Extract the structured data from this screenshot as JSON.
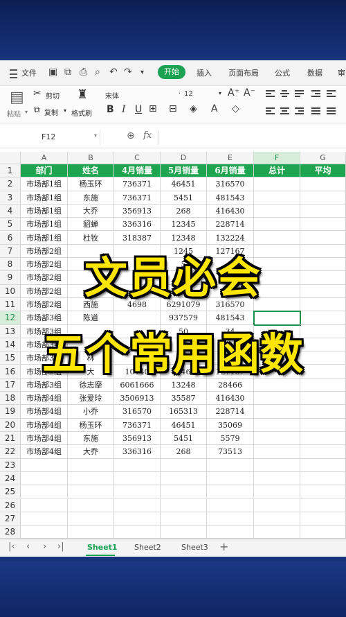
{
  "menu": {
    "file": "文件",
    "active_tab": "开始",
    "tabs": [
      "插入",
      "页面布局",
      "公式",
      "数据",
      "审"
    ]
  },
  "ribbon": {
    "cut": "剪切",
    "paste": "粘贴",
    "copy": "复制",
    "format_painter": "格式刷",
    "font_name": "宋体",
    "font_size": "12"
  },
  "formula_bar": {
    "cell_ref": "F12",
    "fx": "fx"
  },
  "columns": [
    "A",
    "B",
    "C",
    "D",
    "E",
    "F",
    "G"
  ],
  "header_row": [
    "部门",
    "姓名",
    "4月销量",
    "5月销量",
    "6月销量",
    "总计",
    "平均"
  ],
  "rows": [
    [
      "市场部1组",
      "杨玉环",
      "736371",
      "46451",
      "316570",
      "",
      ""
    ],
    [
      "市场部1组",
      "东施",
      "736371",
      "5451",
      "481543",
      "",
      ""
    ],
    [
      "市场部1组",
      "大乔",
      "356913",
      "268",
      "416430",
      "",
      ""
    ],
    [
      "市场部1组",
      "貂蝉",
      "336316",
      "12345",
      "228714",
      "",
      ""
    ],
    [
      "市场部1组",
      "杜牧",
      "318387",
      "12348",
      "132224",
      "",
      ""
    ],
    [
      "市场部2组",
      "",
      "",
      "1245",
      "127167",
      "",
      ""
    ],
    [
      "市场部2组",
      "",
      "",
      "5",
      "",
      "",
      ""
    ],
    [
      "市场部2组",
      "",
      "",
      "",
      "",
      "",
      ""
    ],
    [
      "市场部2组",
      "",
      "",
      "31",
      "366",
      "",
      ""
    ],
    [
      "市场部2组",
      "西施",
      "4698",
      "6291079",
      "316570",
      "",
      ""
    ],
    [
      "市场部3组",
      "陈道",
      "",
      "937579",
      "481543",
      "",
      ""
    ],
    [
      "市场部3组",
      "",
      "",
      "50",
      "34",
      "",
      ""
    ],
    [
      "市场部3组",
      "",
      "",
      "79",
      "",
      "",
      ""
    ],
    [
      "市场部3组",
      "林",
      "",
      "1",
      "",
      "",
      ""
    ],
    [
      "市场部3组",
      "大",
      "10140",
      "13465",
      "127167",
      "",
      ""
    ],
    [
      "市场部3组",
      "徐志摩",
      "6061666",
      "13248",
      "28466",
      "",
      ""
    ],
    [
      "市场部4组",
      "张爱玲",
      "3506913",
      "35587",
      "416430",
      "",
      ""
    ],
    [
      "市场部4组",
      "小乔",
      "316570",
      "165313",
      "228714",
      "",
      ""
    ],
    [
      "市场部4组",
      "杨玉环",
      "736371",
      "46451",
      "35069",
      "",
      ""
    ],
    [
      "市场部4组",
      "东施",
      "356913",
      "5451",
      "5579",
      "",
      ""
    ],
    [
      "市场部4组",
      "大乔",
      "336316",
      "268",
      "73513",
      "",
      ""
    ]
  ],
  "empty_row_numbers": [
    23,
    24,
    25,
    26,
    27,
    28
  ],
  "overlay": {
    "line1": "文员必会",
    "line2": "五个常用函数"
  },
  "sheet_tabs": [
    "Sheet1",
    "Sheet2",
    "Sheet3"
  ],
  "active_sheet": "Sheet1",
  "colors": {
    "accent": "#1aa152",
    "header_fill": "#1fa54f",
    "overlay_text": "#ffe600",
    "background": "#16327a"
  }
}
